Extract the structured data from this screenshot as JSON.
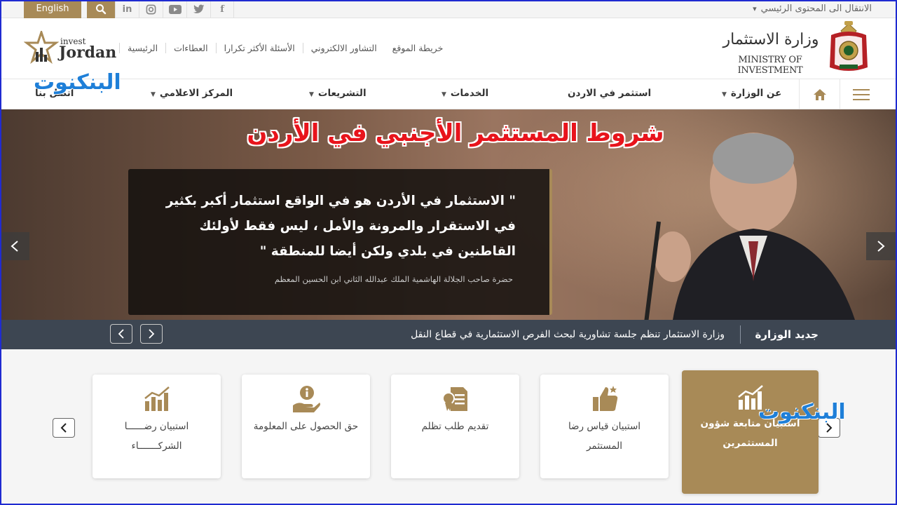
{
  "topbar": {
    "language_label": "English",
    "skip_link": "الانتقال الى المحتوى الرئيسي",
    "social": [
      "in",
      "ig",
      "yt",
      "tw",
      "f"
    ]
  },
  "header": {
    "ministry_name_ar": "وزارة الاستثمار",
    "ministry_name_en": "MINISTRY OF INVESTMENT",
    "invest_small": "invest",
    "invest_big": "Jordan",
    "quick_links": [
      "الرئيسية",
      "العطاءات",
      "الأسئلة الأكثر تكرارا",
      "التشاور الالكتروني",
      "خريطة الموقع"
    ]
  },
  "nav": {
    "items": [
      {
        "label": "عن الوزارة"
      },
      {
        "label": "استثمر في الاردن"
      },
      {
        "label": "الخدمات"
      },
      {
        "label": "التشريعات"
      },
      {
        "label": "المركز الاعلامي"
      },
      {
        "label": "اتصل بنا"
      }
    ]
  },
  "watermark": "البنكنوت",
  "hero": {
    "headline": "شروط المستثمر الأجنبي في الأردن",
    "quote": "\" الاستثمار في الأردن هو في الواقع استثمار أكبر بكثير في الاستقرار والمرونة والأمل ، ليس فقط لأولئك القاطنين في بلدي ولكن أيضا للمنطقة \"",
    "author": "حضرة صاحب الجلالة الهاشمية الملك عبدالله الثاني ابن الحسين المعظم"
  },
  "ticker": {
    "title": "جديد الوزارة",
    "text": "وزارة الاستثمار تنظم جلسة تشاورية لبحث الفرص الاستثمارية في قطاع النقل"
  },
  "services": [
    {
      "label": "استبيان متابعة شؤون المستثمرين",
      "icon": "bar-chart-icon",
      "active": true
    },
    {
      "label": "استبيان قياس رضا المستثمر",
      "icon": "thumbs-up-icon",
      "active": false
    },
    {
      "label": "تقديم طلب تظلم",
      "icon": "certificate-icon",
      "active": false
    },
    {
      "label": "حق الحصول على المعلومة",
      "icon": "info-hand-icon",
      "active": false
    },
    {
      "label": "استبيان رضــــــا الشركـــــــاء",
      "icon": "bar-chart-icon",
      "active": false
    }
  ],
  "colors": {
    "accent": "#a88a57",
    "ticker_bg": "#3d4652",
    "headline": "#e8141c",
    "watermark": "#1e7fd8"
  }
}
